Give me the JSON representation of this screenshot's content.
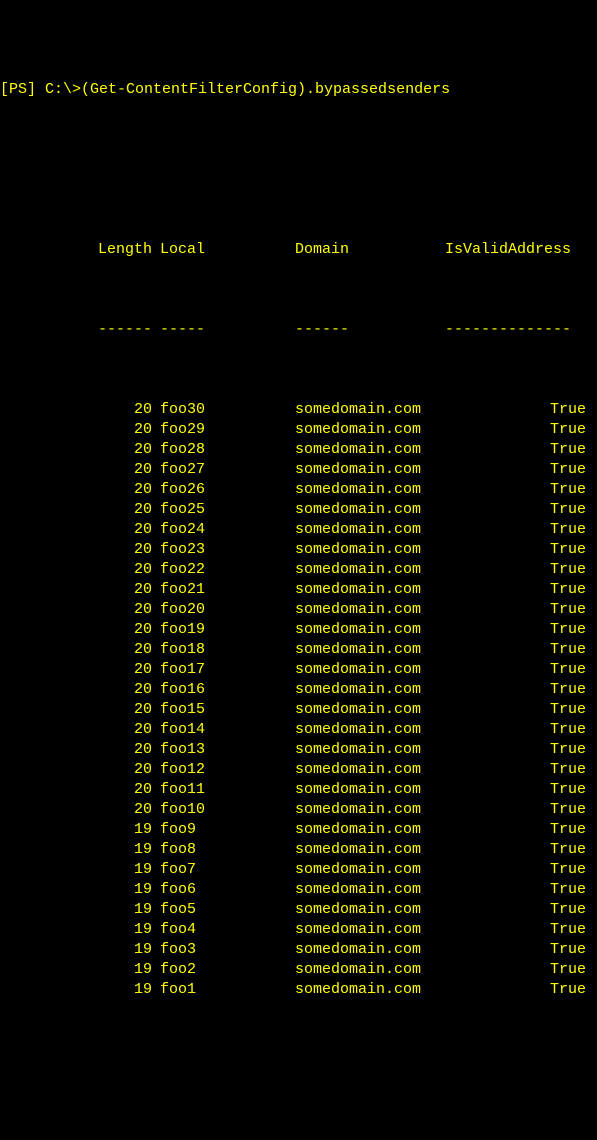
{
  "prompt": "[PS] C:\\>(Get-ContentFilterConfig).bypassedsenders",
  "headers": {
    "length": "Length",
    "local": "Local",
    "domain": "Domain",
    "valid": "IsValidAddress"
  },
  "separators": {
    "length": "------",
    "local": "-----",
    "domain": "------",
    "valid": "--------------"
  },
  "rows": [
    {
      "length": "20",
      "local": "foo30",
      "domain": "somedomain.com",
      "valid": "True"
    },
    {
      "length": "20",
      "local": "foo29",
      "domain": "somedomain.com",
      "valid": "True"
    },
    {
      "length": "20",
      "local": "foo28",
      "domain": "somedomain.com",
      "valid": "True"
    },
    {
      "length": "20",
      "local": "foo27",
      "domain": "somedomain.com",
      "valid": "True"
    },
    {
      "length": "20",
      "local": "foo26",
      "domain": "somedomain.com",
      "valid": "True"
    },
    {
      "length": "20",
      "local": "foo25",
      "domain": "somedomain.com",
      "valid": "True"
    },
    {
      "length": "20",
      "local": "foo24",
      "domain": "somedomain.com",
      "valid": "True"
    },
    {
      "length": "20",
      "local": "foo23",
      "domain": "somedomain.com",
      "valid": "True"
    },
    {
      "length": "20",
      "local": "foo22",
      "domain": "somedomain.com",
      "valid": "True"
    },
    {
      "length": "20",
      "local": "foo21",
      "domain": "somedomain.com",
      "valid": "True"
    },
    {
      "length": "20",
      "local": "foo20",
      "domain": "somedomain.com",
      "valid": "True"
    },
    {
      "length": "20",
      "local": "foo19",
      "domain": "somedomain.com",
      "valid": "True"
    },
    {
      "length": "20",
      "local": "foo18",
      "domain": "somedomain.com",
      "valid": "True"
    },
    {
      "length": "20",
      "local": "foo17",
      "domain": "somedomain.com",
      "valid": "True"
    },
    {
      "length": "20",
      "local": "foo16",
      "domain": "somedomain.com",
      "valid": "True"
    },
    {
      "length": "20",
      "local": "foo15",
      "domain": "somedomain.com",
      "valid": "True"
    },
    {
      "length": "20",
      "local": "foo14",
      "domain": "somedomain.com",
      "valid": "True"
    },
    {
      "length": "20",
      "local": "foo13",
      "domain": "somedomain.com",
      "valid": "True"
    },
    {
      "length": "20",
      "local": "foo12",
      "domain": "somedomain.com",
      "valid": "True"
    },
    {
      "length": "20",
      "local": "foo11",
      "domain": "somedomain.com",
      "valid": "True"
    },
    {
      "length": "20",
      "local": "foo10",
      "domain": "somedomain.com",
      "valid": "True"
    },
    {
      "length": "19",
      "local": "foo9",
      "domain": "somedomain.com",
      "valid": "True"
    },
    {
      "length": "19",
      "local": "foo8",
      "domain": "somedomain.com",
      "valid": "True"
    },
    {
      "length": "19",
      "local": "foo7",
      "domain": "somedomain.com",
      "valid": "True"
    },
    {
      "length": "19",
      "local": "foo6",
      "domain": "somedomain.com",
      "valid": "True"
    },
    {
      "length": "19",
      "local": "foo5",
      "domain": "somedomain.com",
      "valid": "True"
    },
    {
      "length": "19",
      "local": "foo4",
      "domain": "somedomain.com",
      "valid": "True"
    },
    {
      "length": "19",
      "local": "foo3",
      "domain": "somedomain.com",
      "valid": "True"
    },
    {
      "length": "19",
      "local": "foo2",
      "domain": "somedomain.com",
      "valid": "True"
    },
    {
      "length": "19",
      "local": "foo1",
      "domain": "somedomain.com",
      "valid": "True"
    }
  ]
}
